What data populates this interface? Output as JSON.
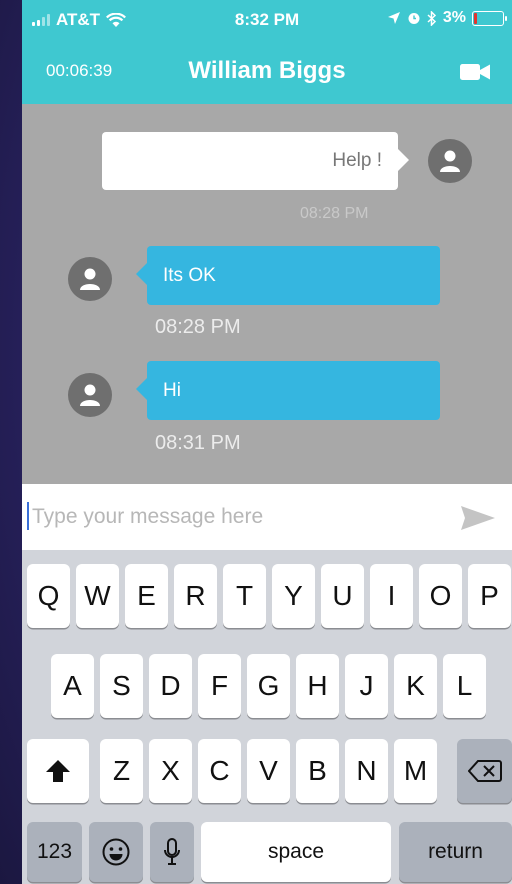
{
  "status_bar": {
    "carrier": "AT&T",
    "time": "8:32 PM",
    "battery": "3%"
  },
  "header": {
    "call_timer": "00:06:39",
    "title": "William Biggs",
    "video_icon": "video-camera-icon"
  },
  "messages": [
    {
      "direction": "out",
      "text": "Help !",
      "time": "08:28 PM"
    },
    {
      "direction": "in",
      "text": "Its OK",
      "time": "08:28 PM"
    },
    {
      "direction": "in",
      "text": "Hi",
      "time": "08:31 PM"
    }
  ],
  "composer": {
    "placeholder": "Type your message here",
    "value": "",
    "send_icon": "send-arrow-icon"
  },
  "keyboard": {
    "row1": [
      "Q",
      "W",
      "E",
      "R",
      "T",
      "Y",
      "U",
      "I",
      "O",
      "P"
    ],
    "row2": [
      "A",
      "S",
      "D",
      "F",
      "G",
      "H",
      "J",
      "K",
      "L"
    ],
    "row3": [
      "Z",
      "X",
      "C",
      "V",
      "B",
      "N",
      "M"
    ],
    "numbers_label": "123",
    "space_label": "space",
    "return_label": "return"
  },
  "colors": {
    "header": "#3fc8d0",
    "incoming_bubble": "#35b6e0",
    "chat_background": "#a8a8a8"
  }
}
